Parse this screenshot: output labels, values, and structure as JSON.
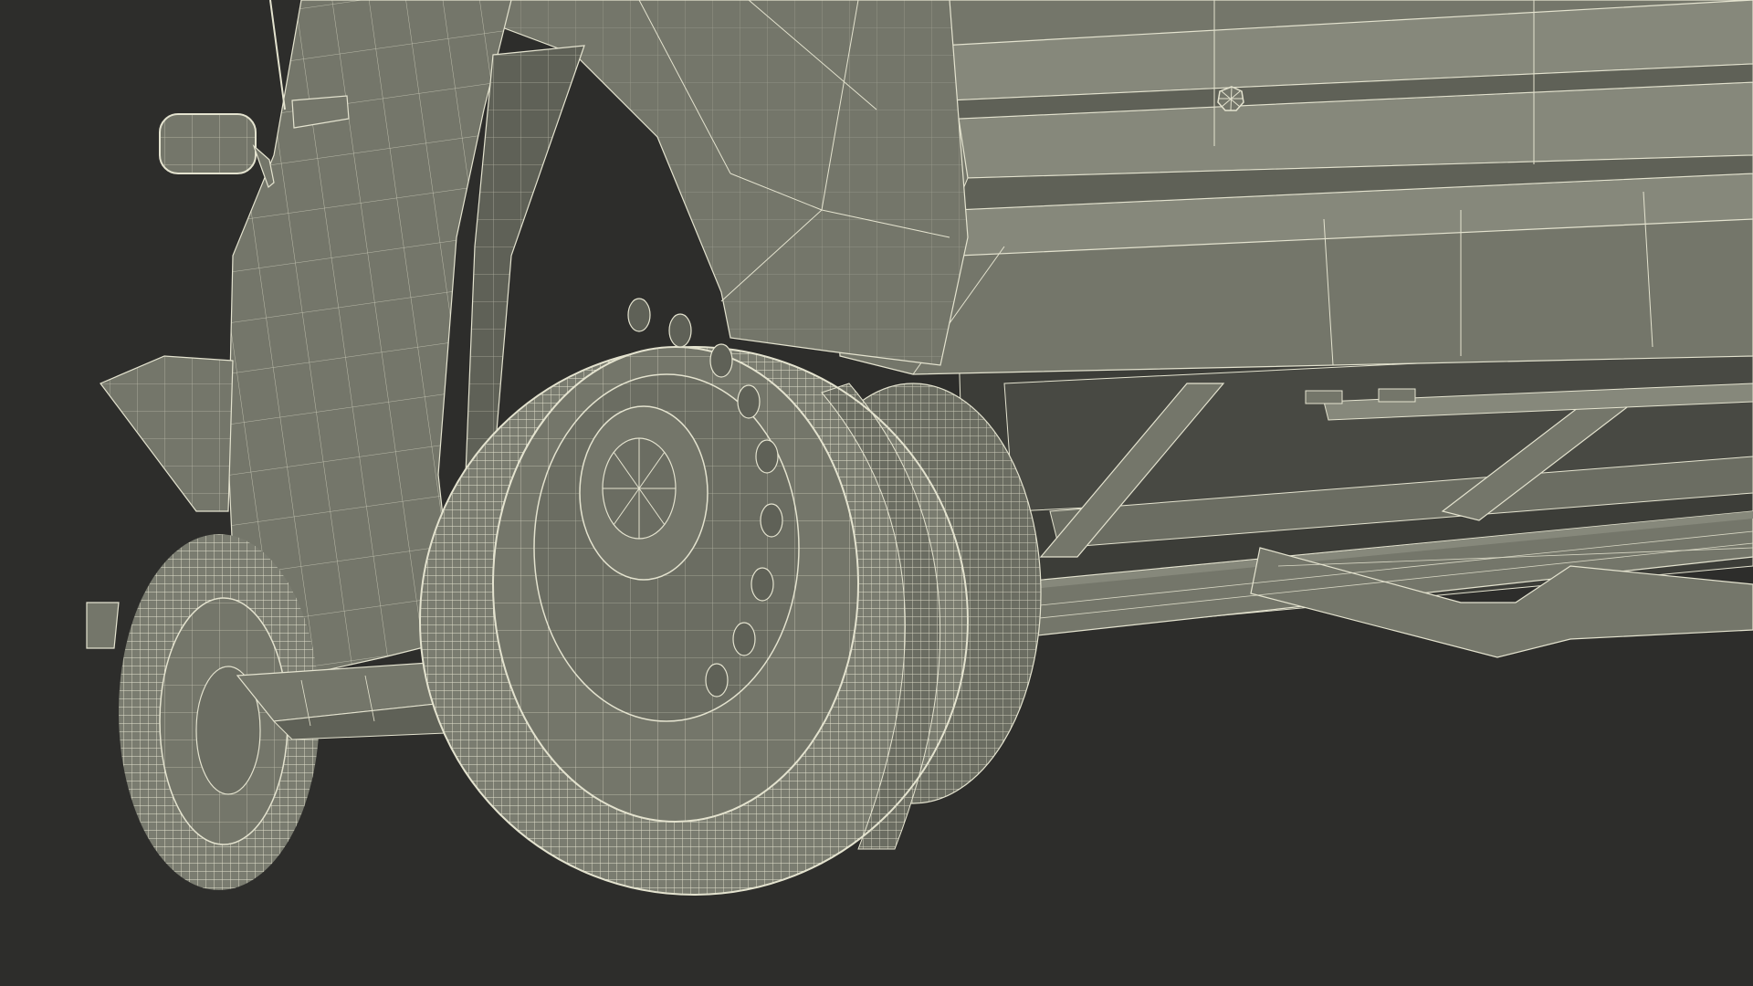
{
  "scene": {
    "kind": "3d-wireframe-render",
    "subject": "vehicle-rear-wheel-and-chassis",
    "colors": {
      "background": "#2d2d2b",
      "surface": "#74766a",
      "surface_dark": "#5f6157",
      "surface_light": "#86887b",
      "underbody": "#3c3d38",
      "wire": "#e4e3cf"
    }
  }
}
